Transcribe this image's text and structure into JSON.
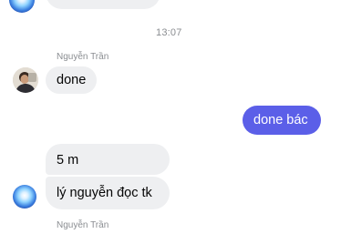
{
  "thread": {
    "timestamp": "13:07",
    "messages": [
      {
        "sender": "Nguyễn Trần",
        "text": "done",
        "direction": "incoming"
      },
      {
        "text": "done bác",
        "direction": "outgoing"
      },
      {
        "text": "5 m",
        "direction": "incoming"
      },
      {
        "text": "lý nguyễn đọc tk",
        "direction": "incoming"
      }
    ],
    "footer_sender": "Nguyễn Trần"
  },
  "colors": {
    "outgoing_bubble": "#5b5fe8",
    "incoming_bubble": "#eeeff1",
    "meta_text": "#8a8d91"
  },
  "icons": {
    "orb_avatar": "glowing-orb-avatar",
    "person_avatar": "person-photo-avatar"
  }
}
